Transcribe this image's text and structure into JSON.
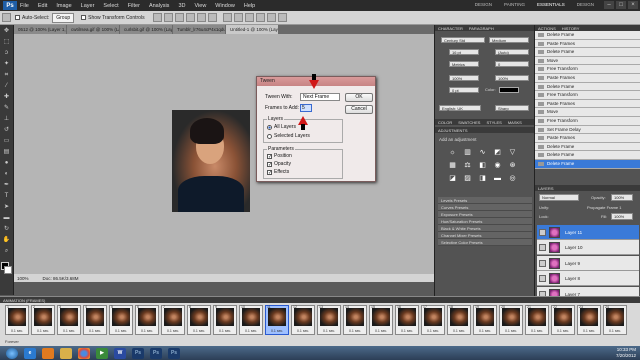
{
  "menubar": {
    "logo": "Ps",
    "items": [
      "File",
      "Edit",
      "Image",
      "Layer",
      "Select",
      "Filter",
      "Analysis",
      "3D",
      "View",
      "Window",
      "Help"
    ],
    "workspaces": [
      "DESIGN",
      "PAINTING",
      "ESSENTIALS",
      "DESIGN"
    ]
  },
  "options": {
    "auto_select_label": "Auto-Select:",
    "auto_select_value": "Group",
    "show_transform_label": "Show Transform Controls"
  },
  "tabs": [
    "0512 @ 100% (Layer 1, RGB/8)",
    "cwtilrsea.gif @ 100% (Layer 1, RGB/8)",
    "curlsbit.gif @ 100% (Layer 1, RGB/8)",
    "Tumblr_lr76u4cP4x1qdu...",
    "Untitled-1 @ 100% (Layer 11, RGB/8)"
  ],
  "dialog": {
    "title": "Tween",
    "tween_with_label": "Tween With:",
    "tween_with_value": "Next Frame",
    "frames_label": "Frames to Add:",
    "frames_value": "5",
    "ok": "OK",
    "cancel": "Cancel",
    "layers_group": "Layers",
    "all_layers": "All Layers",
    "selected_layers": "Selected Layers",
    "params_group": "Parameters",
    "position": "Position",
    "opacity": "Opacity",
    "effects": "Effects"
  },
  "status": {
    "zoom": "100%",
    "doc": "Doc: 86.5K/3.68M"
  },
  "animation": {
    "title": "ANIMATION (FRAMES)",
    "delay": "0.1 sec.",
    "loop": "Forever",
    "frames": [
      "1",
      "2",
      "3",
      "4",
      "5",
      "6",
      "7",
      "8",
      "9",
      "10",
      "11",
      "12",
      "13",
      "14",
      "15",
      "16",
      "17",
      "18",
      "19",
      "20",
      "21",
      "22",
      "23",
      "24"
    ],
    "selected_index": 10
  },
  "right_panel": {
    "char_tabs": [
      "CHARACTER",
      "PARAGRAPH"
    ],
    "font_family": "Century Std",
    "font_style": "Medium",
    "font_size": "16 pt",
    "leading": "(Auto)",
    "tracking": "Metrics",
    "kerning": "0",
    "scale_v": "100%",
    "scale_h": "100%",
    "baseline": "0 pt",
    "color_label": "Color:",
    "language": "English: UK",
    "antialias": "Sharp",
    "mid_tabs": [
      "COLOR",
      "SWATCHES",
      "STYLES",
      "MASKS"
    ],
    "adj_title": "ADJUSTMENTS",
    "adj_hint": "Add an adjustment",
    "presets": [
      "Levels Presets",
      "Curves Presets",
      "Exposure Presets",
      "Hue/Saturation Presets",
      "Black & White Presets",
      "Channel Mixer Presets",
      "Selective Color Presets"
    ]
  },
  "history": {
    "tabs": [
      "ACTIONS",
      "HISTORY"
    ],
    "items": [
      "Delete Frame",
      "Paste Frames",
      "Delete Frame",
      "Move",
      "Free Transform",
      "Paste Frames",
      "Delete Frame",
      "Free Transform",
      "Paste Frames",
      "Move",
      "Free Transform",
      "Set Frame Delay",
      "Paste Frames",
      "Delete Frame",
      "Delete Frame",
      "Delete Frame"
    ],
    "selected_index": 15
  },
  "layers": {
    "title": "LAYERS",
    "blend": "Normal",
    "opacity_label": "Opacity:",
    "opacity": "100%",
    "unify_label": "Unify:",
    "propagate": "Propagate Frame 1",
    "lock_label": "Lock:",
    "fill_label": "Fill:",
    "fill": "100%",
    "rows": [
      "Layer 11",
      "Layer 10",
      "Layer 9",
      "Layer 8",
      "Layer 7",
      "Layer 6",
      "Layer 5"
    ],
    "selected_index": 0
  },
  "taskbar": {
    "apps": [
      "start",
      "ie",
      "firefox",
      "explorer",
      "chrome",
      "media",
      "word",
      "photoshop",
      "photoshop",
      "photoshop"
    ],
    "time": "10:33 PM",
    "date": "7/20/2012"
  }
}
